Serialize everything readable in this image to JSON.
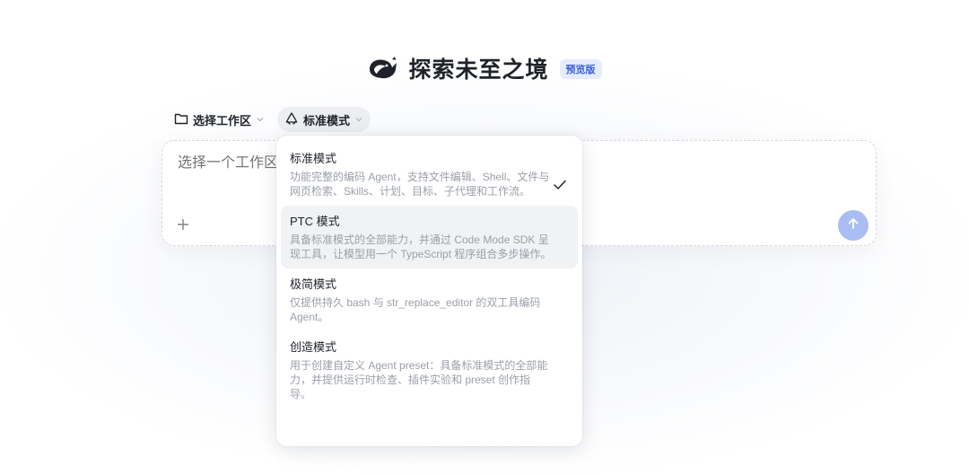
{
  "header": {
    "title": "探索未至之境",
    "badge": "预览版"
  },
  "toolbar": {
    "workspace_label": "选择工作区",
    "mode_label": "标准模式"
  },
  "composer": {
    "placeholder": "选择一个工作区"
  },
  "menu": {
    "items": [
      {
        "name": "标准模式",
        "desc": "功能完整的编码 Agent，支持文件编辑、Shell、文件与网页检索、Skills、计划、目标、子代理和工作流。",
        "selected": true
      },
      {
        "name": "PTC 模式",
        "desc": "具备标准模式的全部能力，并通过 Code Mode SDK 呈现工具，让模型用一个 TypeScript 程序组合多步操作。",
        "selected": false
      },
      {
        "name": "极简模式",
        "desc": "仅提供持久 bash 与 str_replace_editor 的双工具编码 Agent。",
        "selected": false
      },
      {
        "name": "创造模式",
        "desc": "用于创建自定义 Agent preset：具备标准模式的全部能力，并提供运行时检查、插件实验和 preset 创作指导。",
        "selected": false
      }
    ]
  },
  "icons": {
    "logo": "whale-logo-icon",
    "folder": "folder-icon",
    "mode": "recycle-icon",
    "chevron": "chevron-down-icon",
    "check": "check-icon",
    "plus": "plus-icon",
    "send": "arrow-up-icon"
  },
  "colors": {
    "badge_bg": "#e6ecfb",
    "badge_text": "#3b5fd9",
    "send_button": "#a9bdf3",
    "hover_item": "#f1f2f4"
  }
}
